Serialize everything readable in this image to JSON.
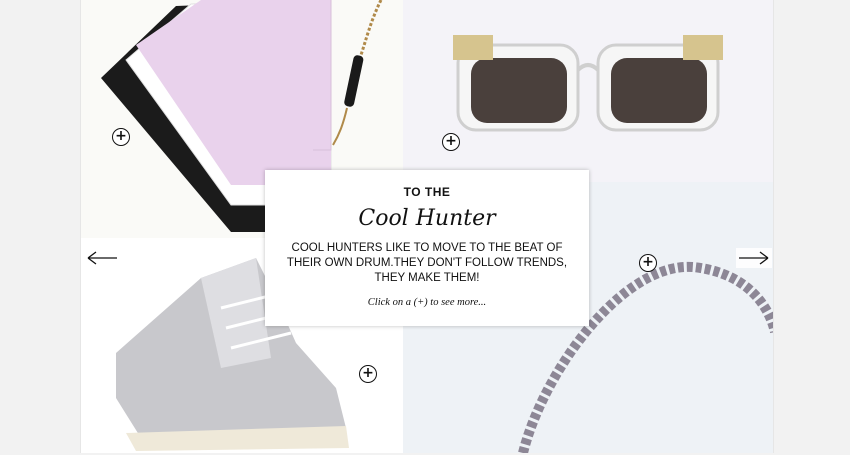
{
  "card": {
    "kicker": "TO THE",
    "title": "Cool Hunter",
    "body": "COOL HUNTERS LIKE TO MOVE TO THE BEAT OF THEIR OWN DRUM.THEY DON'T FOLLOW TRENDS, THEY MAKE THEM!",
    "hint": "Click on a (+) to see more..."
  },
  "products": [
    {
      "name": "clutch bag",
      "expand_label": "+"
    },
    {
      "name": "sunglasses",
      "expand_label": "+"
    },
    {
      "name": "sneakers",
      "expand_label": "+"
    },
    {
      "name": "necklace",
      "expand_label": "+"
    }
  ],
  "icons": {
    "prev": "arrow-left-icon",
    "next": "arrow-right-icon",
    "expand": "plus-circle-icon"
  },
  "colors": {
    "page_bg": "#f2f2f2",
    "clutch_pink": "#e9d2ec",
    "accent_dark": "#111111"
  }
}
